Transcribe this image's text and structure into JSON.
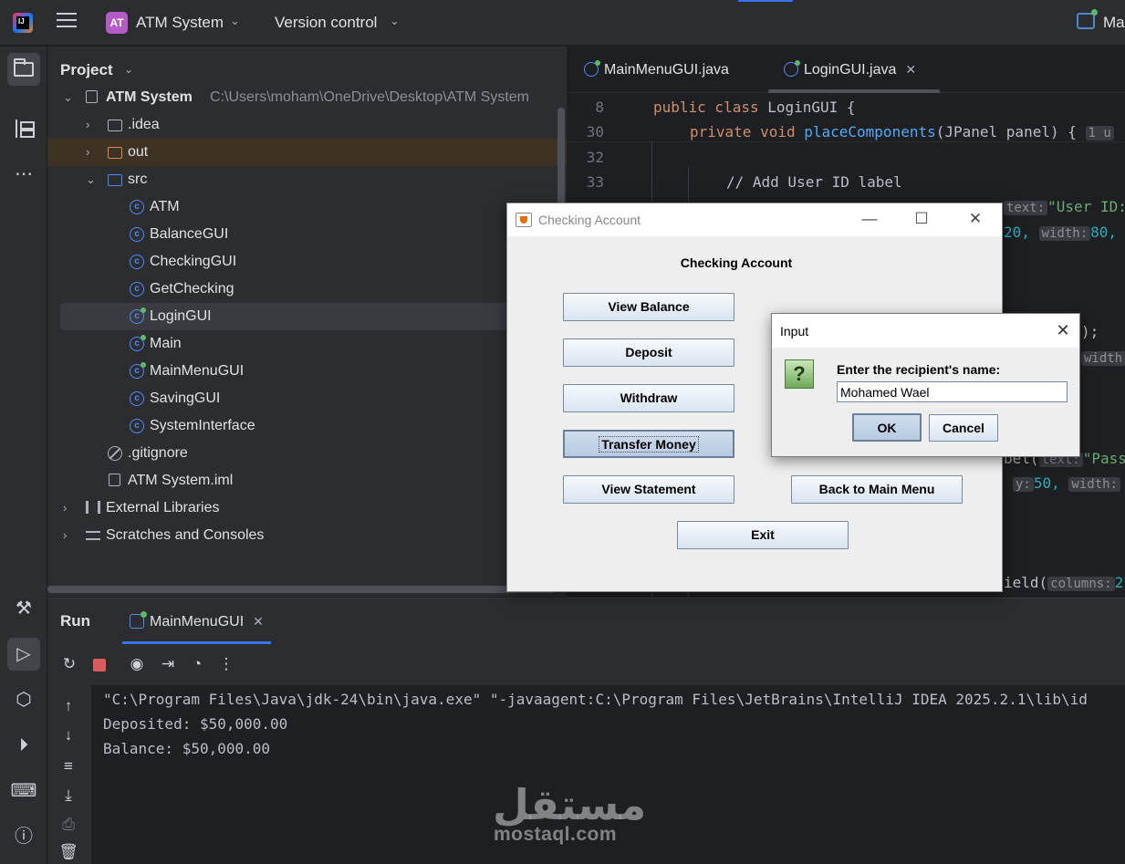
{
  "titlebar": {
    "project_badge": "AT",
    "project_name": "ATM System",
    "vcs_label": "Version control",
    "run_config": "Ma"
  },
  "project_panel": {
    "title": "Project",
    "root_name": "ATM System",
    "root_path": "C:\\Users\\moham\\OneDrive\\Desktop\\ATM System",
    "items": [
      {
        "label": ".idea",
        "icon": "folder-icon"
      },
      {
        "label": "out",
        "icon": "folder-orange-icon"
      },
      {
        "label": "src",
        "icon": "folder-blue-icon"
      },
      {
        "label": "ATM",
        "icon": "class-icon"
      },
      {
        "label": "BalanceGUI",
        "icon": "class-icon"
      },
      {
        "label": "CheckingGUI",
        "icon": "class-icon"
      },
      {
        "label": "GetChecking",
        "icon": "class-icon"
      },
      {
        "label": "LoginGUI",
        "icon": "runnable-class-icon"
      },
      {
        "label": "Main",
        "icon": "runnable-class-icon"
      },
      {
        "label": "MainMenuGUI",
        "icon": "runnable-class-icon"
      },
      {
        "label": "SavingGUI",
        "icon": "class-icon"
      },
      {
        "label": "SystemInterface",
        "icon": "class-icon"
      },
      {
        "label": ".gitignore",
        "icon": "gitignore-icon"
      },
      {
        "label": "ATM System.iml",
        "icon": "iml-file-icon"
      },
      {
        "label": "External Libraries",
        "icon": "library-icon"
      },
      {
        "label": "Scratches and Consoles",
        "icon": "scratches-icon"
      }
    ]
  },
  "editor": {
    "tabs": [
      {
        "label": "MainMenuGUI.java"
      },
      {
        "label": "LoginGUI.java"
      }
    ],
    "lines": {
      "l8_num": "8",
      "l8_kw": "public class ",
      "l8_rest": "LoginGUI {",
      "l30_num": "30",
      "l30_kw": "private void ",
      "l30_fn": "placeComponents",
      "l30_rest": "(JPanel panel) {",
      "l30_hint": "1 u",
      "l32_num": "32",
      "l33_num": "33",
      "l33_comment": "// Add User ID label",
      "frag_text_hint": "text:",
      "frag_userid": "\"User ID:",
      "frag_20": "20,",
      "frag_width_hint": "width:",
      "frag_80": "80,",
      "frag_paren": ");",
      "frag_width_hint2": "width:",
      "frag_1": "1",
      "frag_bel": "bel(",
      "frag_text_hint2": "text:",
      "frag_pass": "\"Pass",
      "frag_y_hint": "y:",
      "frag_50": "50,",
      "frag_width_hint3": "width:",
      "frag_field": "ield(",
      "frag_columns_hint": "columns:",
      "frag_2": "2"
    }
  },
  "run_panel": {
    "title": "Run",
    "tab_label": "MainMenuGUI",
    "console": [
      "\"C:\\Program Files\\Java\\jdk-24\\bin\\java.exe\" \"-javaagent:C:\\Program Files\\JetBrains\\IntelliJ IDEA 2025.2.1\\lib\\id",
      "Deposited: $50,000.00",
      "Balance: $50,000.00"
    ]
  },
  "checking_window": {
    "title": "Checking Account",
    "heading": "Checking Account",
    "buttons": {
      "view_balance": "View Balance",
      "deposit": "Deposit",
      "withdraw": "Withdraw",
      "transfer": "Transfer Money",
      "view_statement": "View Statement",
      "back": "Back to Main Menu",
      "exit": "Exit"
    }
  },
  "input_dialog": {
    "title": "Input",
    "prompt": "Enter the recipient's name:",
    "value": "Mohamed Wael",
    "ok": "OK",
    "cancel": "Cancel"
  },
  "watermark": {
    "arabic": "مستقل",
    "latin": "mostaql.com"
  },
  "colors": {
    "accent": "#3574f0",
    "ide_bg": "#1e1f22",
    "panel_bg": "#2b2d30",
    "keyword": "#cf8e6d",
    "function": "#56a8f5",
    "string": "#6aab73",
    "number": "#2aacb8"
  }
}
